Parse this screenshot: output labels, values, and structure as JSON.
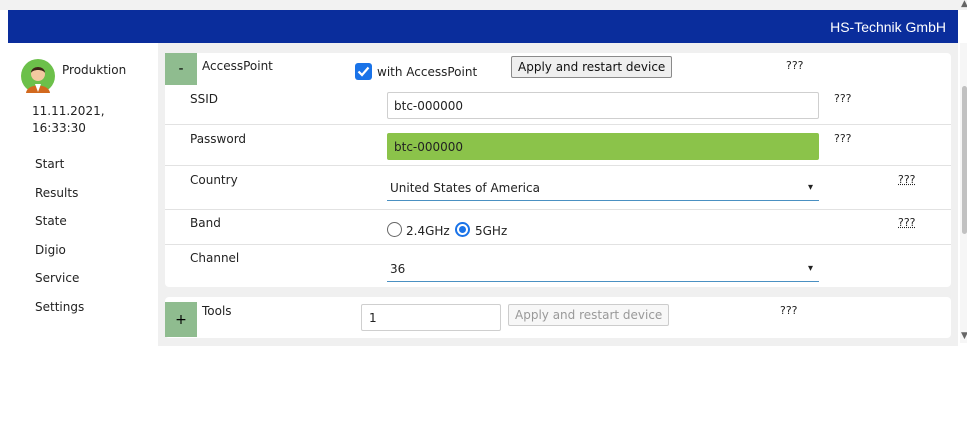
{
  "header": {
    "brand": "HS-Technik GmbH"
  },
  "sidebar": {
    "user": "Produktion",
    "date": "11.11.2021,",
    "time": "16:33:30",
    "items": [
      {
        "label": "Start"
      },
      {
        "label": "Results"
      },
      {
        "label": "State"
      },
      {
        "label": "Digio"
      },
      {
        "label": "Service"
      },
      {
        "label": "Settings"
      }
    ]
  },
  "accesspoint": {
    "toggle": "-",
    "title": "AccessPoint",
    "checkbox_label": "with AccessPoint",
    "checked": true,
    "apply_label": "Apply and restart device",
    "help": "???",
    "rows": {
      "ssid": {
        "label": "SSID",
        "value": "btc-000000",
        "help": "???"
      },
      "password": {
        "label": "Password",
        "value": "btc-000000",
        "help": "???"
      },
      "country": {
        "label": "Country",
        "value": "United States of America",
        "help": "???"
      },
      "band": {
        "label": "Band",
        "option1": "2.4GHz",
        "option2": "5GHz",
        "selected": "5GHz",
        "help": "???"
      },
      "channel": {
        "label": "Channel",
        "value": "36"
      }
    }
  },
  "tools": {
    "toggle": "+",
    "title": "Tools",
    "value": "1",
    "apply_label": "Apply and restart device",
    "help": "???"
  },
  "colors": {
    "header": "#0a2d9c",
    "toggle": "#8fbc8f",
    "password_bg": "#8bc34a",
    "accent": "#1a73e8"
  }
}
